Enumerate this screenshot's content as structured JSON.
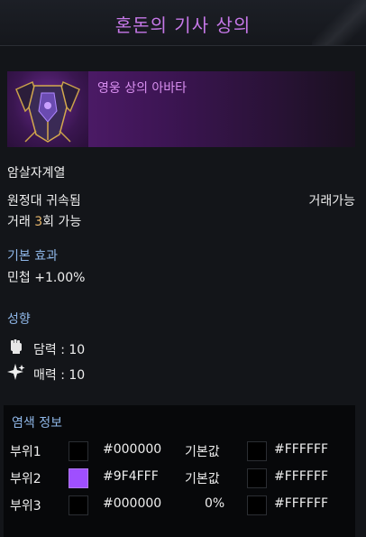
{
  "header": {
    "title": "혼돈의 기사 상의"
  },
  "item": {
    "avatar_type": "영웅 상의 아바타",
    "icon": "armor-chestpiece-icon"
  },
  "info": {
    "class": "암살자계열",
    "bound": "원정대 귀속됨",
    "tradable": "거래가능",
    "trade_prefix": "거래 ",
    "trade_count": "3",
    "trade_suffix": "회 가능"
  },
  "basic_effect": {
    "heading": "기본 효과",
    "stat": "민첩 +1.00%"
  },
  "tendency": {
    "heading": "성향",
    "items": [
      {
        "label": "담력 : 10",
        "icon": "fist-icon"
      },
      {
        "label": "매력 : 10",
        "icon": "sparkle-icon"
      }
    ]
  },
  "dye": {
    "heading": "염색 정보",
    "rows": [
      {
        "part": "부위1",
        "color": "#000000",
        "hex": "#000000",
        "mid": "기본값",
        "color2": "#000000",
        "hex2": "#FFFFFF"
      },
      {
        "part": "부위2",
        "color": "#9F4FFF",
        "hex": "#9F4FFF",
        "mid": "기본값",
        "color2": "#000000",
        "hex2": "#FFFFFF"
      },
      {
        "part": "부위3",
        "color": "#000000",
        "hex": "#000000",
        "mid": "0%",
        "color2": "#000000",
        "hex2": "#FFFFFF"
      }
    ]
  }
}
